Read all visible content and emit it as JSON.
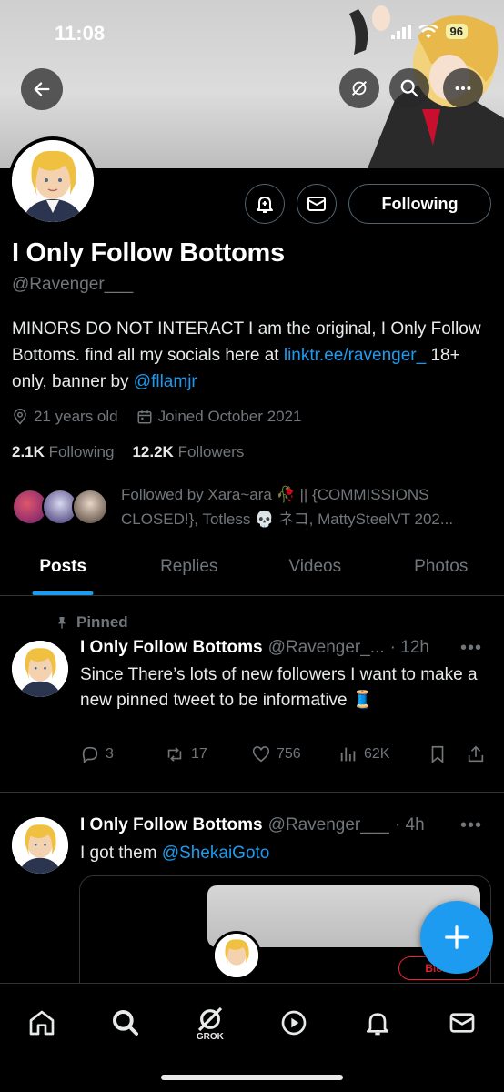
{
  "status_bar": {
    "time": "11:08",
    "battery": "96"
  },
  "profile": {
    "display_name": "I Only Follow Bottoms",
    "handle": "@Ravenger___",
    "bio_text_1": "MINORS DO NOT INTERACT I am the original, I Only Follow Bottoms. find all my socials here at ",
    "bio_link_1": "linktr.ee/ravenger_",
    "bio_text_2": " 18+ only, banner by ",
    "bio_link_2": "@fllamjr",
    "age": "21 years old",
    "joined": "Joined October 2021",
    "following_count": "2.1K",
    "following_label": "Following",
    "followers_count": "12.2K",
    "followers_label": "Followers",
    "followed_by": "Followed by Xara~ara 🥀 || {COMMISSIONS CLOSED!}, Totless 💀 ネコ, MattySteelVT 202..."
  },
  "actions": {
    "follow_state": "Following"
  },
  "tabs": [
    {
      "label": "Posts",
      "active": true
    },
    {
      "label": "Replies",
      "active": false
    },
    {
      "label": "Videos",
      "active": false
    },
    {
      "label": "Photos",
      "active": false
    }
  ],
  "posts": [
    {
      "pinned_label": "Pinned",
      "name": "I Only Follow Bottoms",
      "handle": "@Ravenger_...",
      "time": "· 12h",
      "text": "Since There’s lots of new followers I want to make a new pinned tweet to be informative 🧵",
      "replies": "3",
      "reposts": "17",
      "likes": "756",
      "views": "62K"
    },
    {
      "name": "I Only Follow Bottoms",
      "handle": "@Ravenger___",
      "time": "· 4h",
      "text_prefix": "I got them ",
      "mention": "@ShekaiGoto",
      "embed_button": "Blo..."
    }
  ],
  "nav": {
    "grok_label": "GROK"
  },
  "colors": {
    "accent": "#1d9bf0",
    "background": "#000000",
    "muted": "#71767b"
  }
}
